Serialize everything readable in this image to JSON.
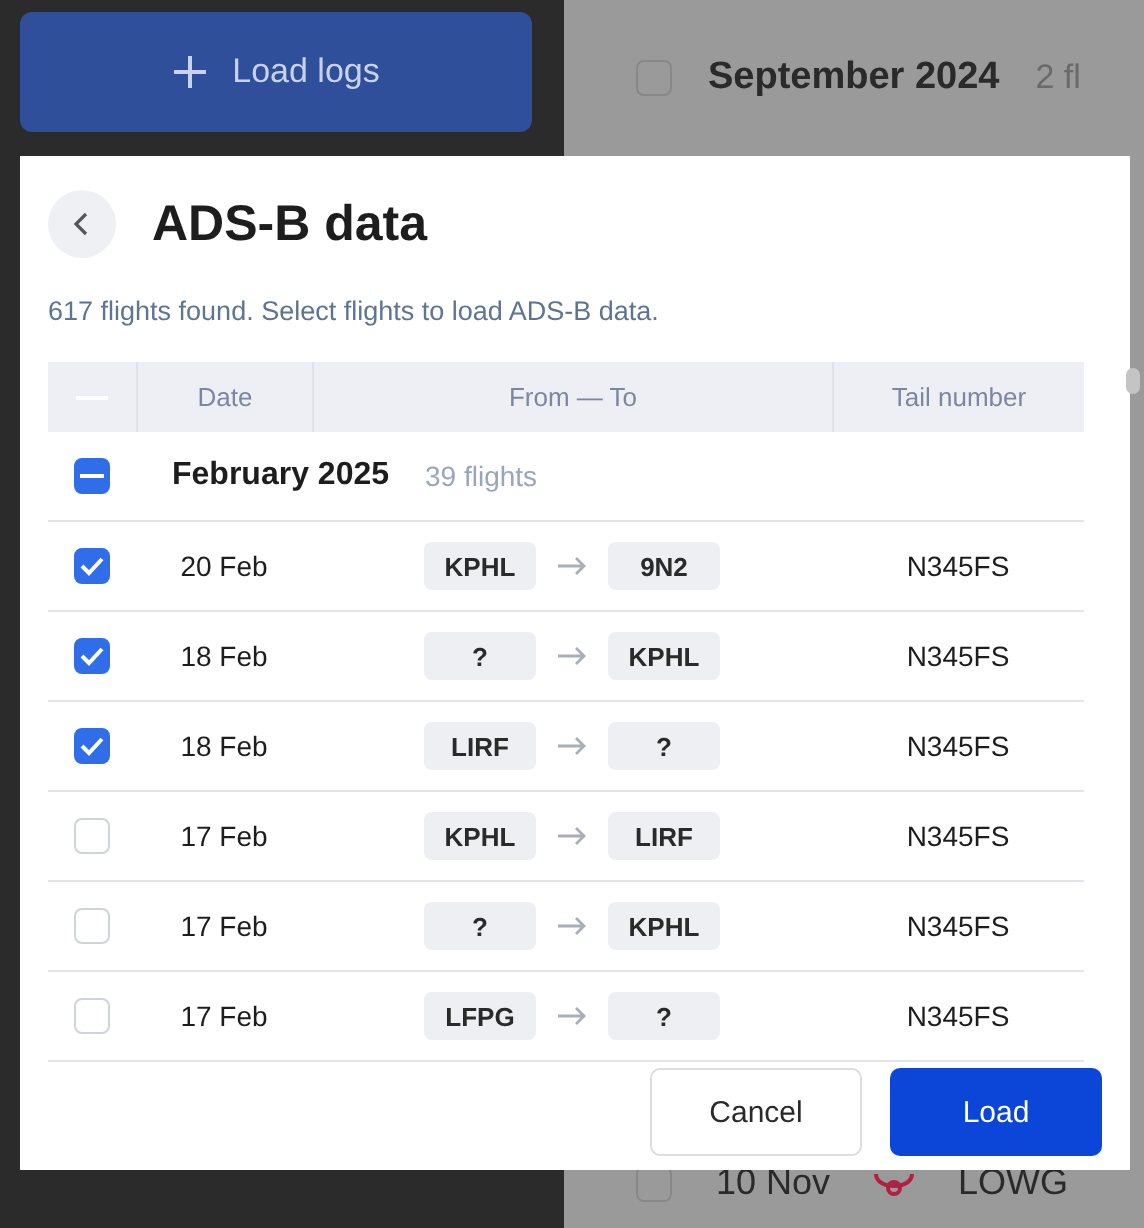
{
  "background": {
    "load_button": "Load logs",
    "month": "September 2024",
    "month_checked": false,
    "month_count": "2 fl",
    "bottom_row": {
      "date": "10 Nov",
      "airport": "LOWG",
      "checked": false
    }
  },
  "dialog": {
    "title": "ADS-B data",
    "subtitle": "617 flights found. Select flights to load ADS-B data.",
    "columns": [
      "Date",
      "From — To",
      "Tail number"
    ],
    "group": {
      "label": "February 2025",
      "count": "39 flights",
      "indeterminate": true
    },
    "rows": [
      {
        "date": "20 Feb",
        "from": "KPHL",
        "to": "9N2",
        "tail": "N345FS",
        "checked": true
      },
      {
        "date": "18 Feb",
        "from": "?",
        "to": "KPHL",
        "tail": "N345FS",
        "checked": true
      },
      {
        "date": "18 Feb",
        "from": "LIRF",
        "to": "?",
        "tail": "N345FS",
        "checked": true
      },
      {
        "date": "17 Feb",
        "from": "KPHL",
        "to": "LIRF",
        "tail": "N345FS",
        "checked": false
      },
      {
        "date": "17 Feb",
        "from": "?",
        "to": "KPHL",
        "tail": "N345FS",
        "checked": false
      },
      {
        "date": "17 Feb",
        "from": "LFPG",
        "to": "?",
        "tail": "N345FS",
        "checked": false
      }
    ],
    "buttons": [
      {
        "label": "Cancel",
        "kind": "secondary"
      },
      {
        "label": "Load",
        "kind": "primary"
      }
    ]
  }
}
